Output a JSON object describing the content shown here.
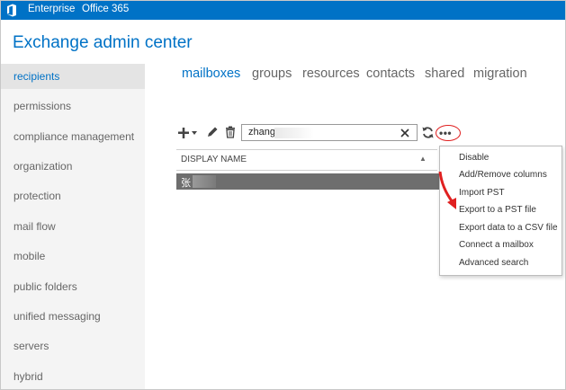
{
  "topbar": {
    "logo_icon": "office-logo-icon",
    "enterprise": "Enterprise",
    "office365": "Office 365",
    "color": "#0072c6"
  },
  "app_title": "Exchange admin center",
  "sidebar": {
    "items": [
      {
        "label": "recipients",
        "active": true
      },
      {
        "label": "permissions"
      },
      {
        "label": "compliance management"
      },
      {
        "label": "organization"
      },
      {
        "label": "protection"
      },
      {
        "label": "mail flow"
      },
      {
        "label": "mobile"
      },
      {
        "label": "public folders"
      },
      {
        "label": "unified messaging"
      },
      {
        "label": "servers"
      },
      {
        "label": "hybrid"
      }
    ]
  },
  "tabs": [
    {
      "label": "mailboxes",
      "active": true
    },
    {
      "label": "groups"
    },
    {
      "label": "resources"
    },
    {
      "label": "contacts"
    },
    {
      "label": "shared"
    },
    {
      "label": "migration"
    }
  ],
  "toolbar": {
    "add_icon": "plus-icon",
    "edit_icon": "pencil-icon",
    "delete_icon": "trash-icon",
    "clear_icon": "close-icon",
    "refresh_icon": "refresh-icon",
    "more_icon": "more-options-icon",
    "search_value": "zhang"
  },
  "grid": {
    "column_header": "DISPLAY NAME",
    "sort_icon": "sort-ascending-icon",
    "rows": [
      {
        "name": "张",
        "selected": true
      }
    ]
  },
  "more_menu": {
    "items": [
      "Disable",
      "Add/Remove columns",
      "Import PST",
      "Export to a PST file",
      "Export data to a CSV file",
      "Connect a mailbox",
      "Advanced search"
    ]
  },
  "annotation": {
    "highlight_color": "#e02020"
  }
}
